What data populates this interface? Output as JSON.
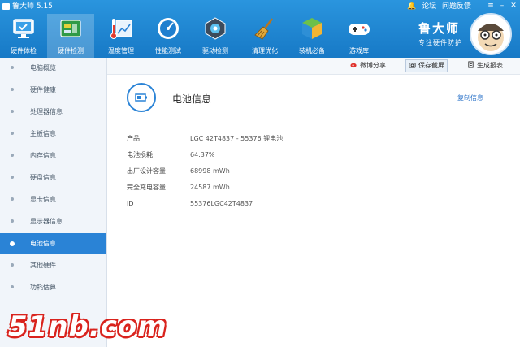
{
  "window": {
    "title": "鲁大师 5.15",
    "links": [
      "论坛",
      "问题反馈"
    ]
  },
  "toolbar": [
    {
      "label": "硬件体检",
      "icon": "monitor-check-icon"
    },
    {
      "label": "硬件检测",
      "icon": "circuit-board-icon",
      "active": true
    },
    {
      "label": "温度管理",
      "icon": "thermometer-chart-icon"
    },
    {
      "label": "性能测试",
      "icon": "speedometer-icon"
    },
    {
      "label": "驱动检测",
      "icon": "driver-chip-icon"
    },
    {
      "label": "清理优化",
      "icon": "broom-icon"
    },
    {
      "label": "装机必备",
      "icon": "package-cube-icon"
    },
    {
      "label": "游戏库",
      "icon": "gamepad-icon"
    }
  ],
  "brand": {
    "name": "鲁大师",
    "slogan": "专注硬件防护"
  },
  "sidebar": [
    {
      "label": "电脑概览"
    },
    {
      "label": "硬件健康"
    },
    {
      "label": "处理器信息"
    },
    {
      "label": "主板信息"
    },
    {
      "label": "内存信息"
    },
    {
      "label": "硬盘信息"
    },
    {
      "label": "显卡信息"
    },
    {
      "label": "显示器信息"
    },
    {
      "label": "电池信息",
      "active": true
    },
    {
      "label": "其他硬件"
    },
    {
      "label": "功耗估算"
    }
  ],
  "actions": {
    "share": "微博分享",
    "screenshot": "保存截屏",
    "report": "生成报表"
  },
  "section": {
    "title": "电池信息",
    "copy": "复制信息"
  },
  "battery_info": [
    {
      "key": "产品",
      "value": "LGC 42T4837 - 55376 锂电池"
    },
    {
      "key": "电池损耗",
      "value": "64.37%"
    },
    {
      "key": "出厂设计容量",
      "value": "68998 mWh"
    },
    {
      "key": "完全充电容量",
      "value": "24587 mWh"
    },
    {
      "key": "ID",
      "value": "55376LGC42T4837"
    }
  ],
  "watermark": "51nb.com",
  "colors": {
    "header": "#1e86d3",
    "accent": "#2a83d6",
    "sidebar_bg": "#f1f5fa",
    "watermark": "#d9231d"
  }
}
